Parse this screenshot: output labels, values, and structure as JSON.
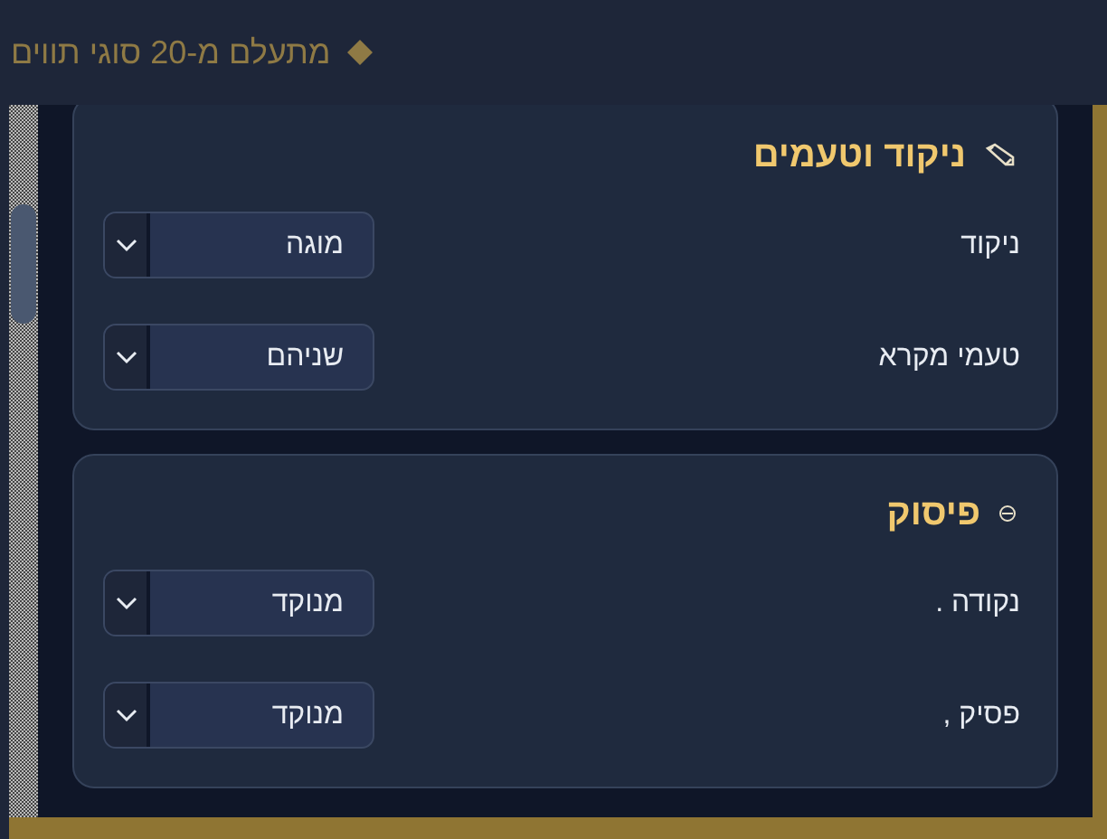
{
  "header": {
    "text": "מתעלם מ-20 סוגי תווים"
  },
  "sections": [
    {
      "kind": "pencil",
      "title": "ניקוד וטעמים",
      "rows": [
        {
          "label": "ניקוד",
          "value": "מוגה"
        },
        {
          "label": "טעמי מקרא",
          "value": "שניהם"
        }
      ]
    },
    {
      "kind": "theta",
      "title": "פיסוק",
      "rows": [
        {
          "label": "נקודה .",
          "value": "מנוקד"
        },
        {
          "label": "פסיק ,",
          "value": "מנוקד"
        }
      ]
    }
  ]
}
